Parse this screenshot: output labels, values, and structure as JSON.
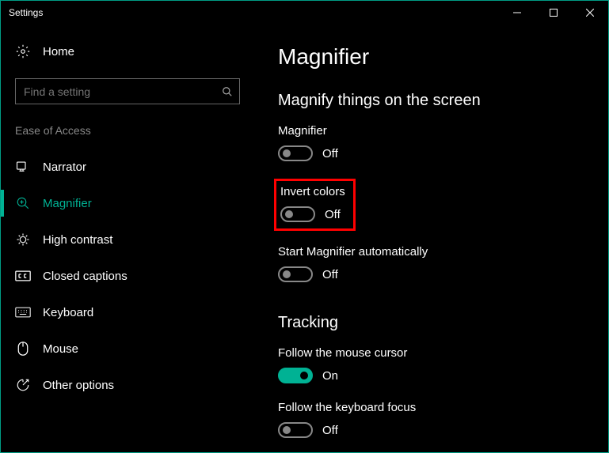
{
  "window": {
    "title": "Settings"
  },
  "sidebar": {
    "home_label": "Home",
    "search_placeholder": "Find a setting",
    "category": "Ease of Access",
    "items": [
      {
        "label": "Narrator"
      },
      {
        "label": "Magnifier"
      },
      {
        "label": "High contrast"
      },
      {
        "label": "Closed captions"
      },
      {
        "label": "Keyboard"
      },
      {
        "label": "Mouse"
      },
      {
        "label": "Other options"
      }
    ]
  },
  "main": {
    "title": "Magnifier",
    "section1_heading": "Magnify things on the screen",
    "settings": [
      {
        "label": "Magnifier",
        "state_text": "Off",
        "on": false
      },
      {
        "label": "Invert colors",
        "state_text": "Off",
        "on": false
      },
      {
        "label": "Start Magnifier automatically",
        "state_text": "Off",
        "on": false
      }
    ],
    "section2_heading": "Tracking",
    "tracking": [
      {
        "label": "Follow the mouse cursor",
        "state_text": "On",
        "on": true
      },
      {
        "label": "Follow the keyboard focus",
        "state_text": "Off",
        "on": false
      }
    ]
  },
  "colors": {
    "accent": "#00b294",
    "highlight": "#ff0000"
  }
}
